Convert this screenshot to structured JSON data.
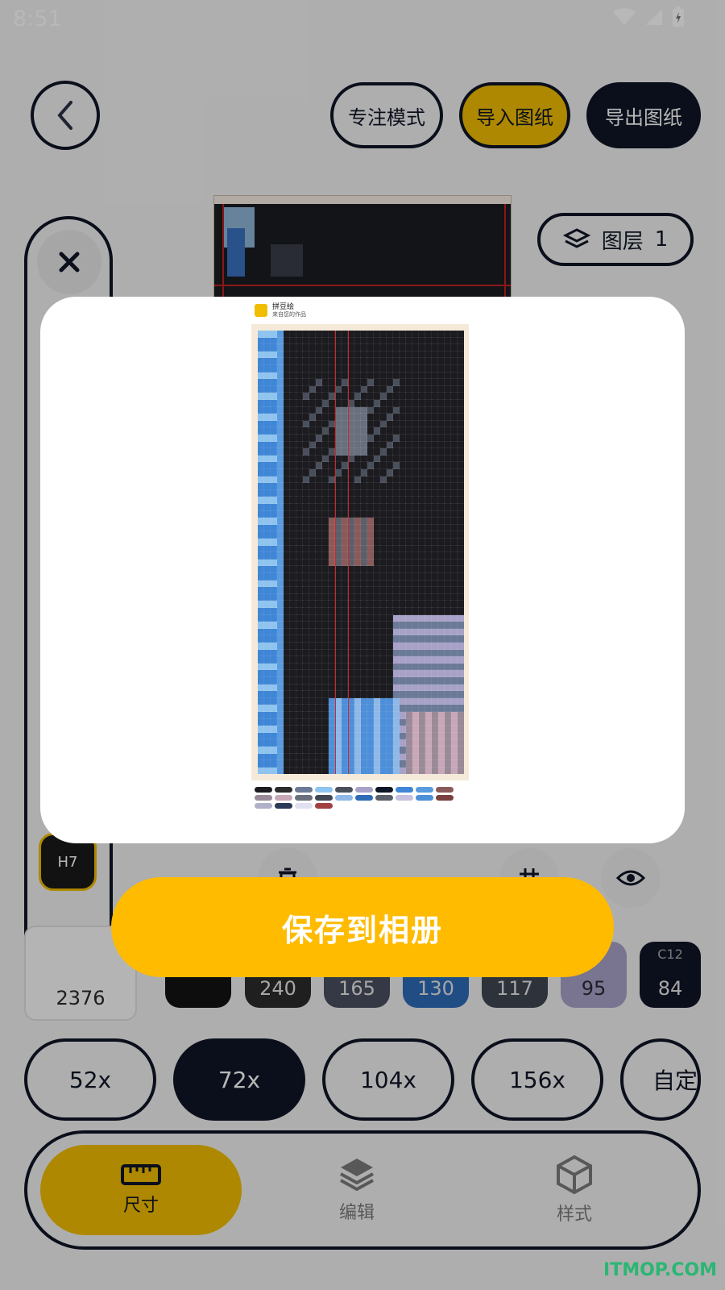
{
  "status_bar": {
    "time": "8:51"
  },
  "top_bar": {
    "focus_mode": "专注模式",
    "import_pattern": "导入图纸",
    "export_pattern": "导出图纸"
  },
  "layer": {
    "label": "图层",
    "count": "1"
  },
  "tool_strip": {
    "selected_color_code": "H7"
  },
  "palette": {
    "total": "2376",
    "swatches": [
      {
        "code": "",
        "count": "",
        "color": "#121212"
      },
      {
        "code": "",
        "count": "240",
        "color": "#2c2c2c"
      },
      {
        "code": "",
        "count": "165",
        "color": "#4a5060"
      },
      {
        "code": "",
        "count": "130",
        "color": "#2d6bb8"
      },
      {
        "code": "",
        "count": "117",
        "color": "#404652"
      },
      {
        "code": "",
        "count": "95",
        "color": "#a8a2c8"
      },
      {
        "code": "C12",
        "count": "84",
        "color": "#0e1526"
      }
    ]
  },
  "sizes": [
    "52x",
    "72x",
    "104x",
    "156x",
    "自定义"
  ],
  "tabs": [
    {
      "label": "尺寸",
      "icon": "ruler-icon"
    },
    {
      "label": "编辑",
      "icon": "layers-icon"
    },
    {
      "label": "样式",
      "icon": "cube-icon"
    }
  ],
  "sheet": {
    "title": "拼豆绘",
    "subtitle": "来自您的作品"
  },
  "save_button": "保存到相册",
  "watermark": "ITMOP.COM",
  "colors": {
    "accent": "#f0bd00",
    "save": "#ffbb00",
    "dark": "#0e1526"
  }
}
